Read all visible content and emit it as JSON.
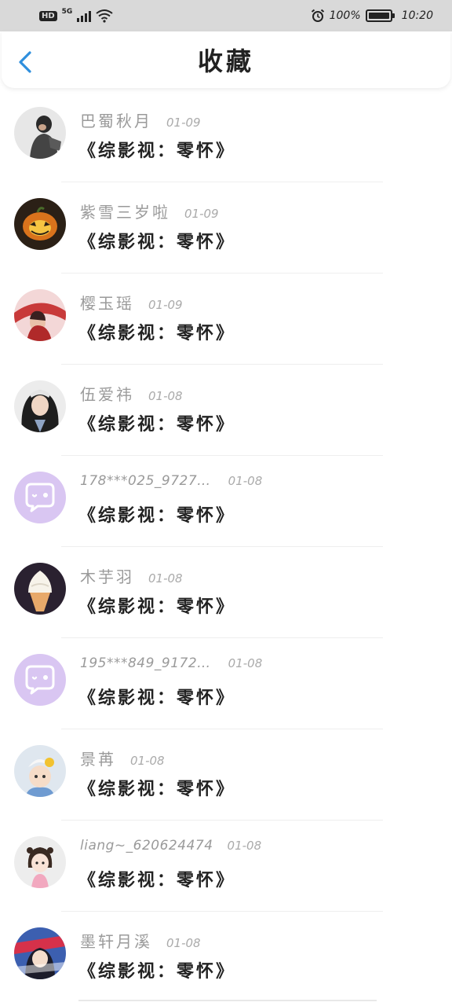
{
  "status_bar": {
    "hd": "HD",
    "network": "5G",
    "battery": "100%",
    "time": "10:20"
  },
  "header": {
    "title": "收藏",
    "back_icon": "chevron-left-icon",
    "accent_color": "#2f8fdd"
  },
  "items": [
    {
      "name": "巴蜀秋月",
      "date": "01-09",
      "title": "《综影视：零怀》",
      "avatar": "photo"
    },
    {
      "name": "紫雪三岁啦",
      "date": "01-09",
      "title": "《综影视：零怀》",
      "avatar": "photo"
    },
    {
      "name": "樱玉瑶",
      "date": "01-09",
      "title": "《综影视：零怀》",
      "avatar": "photo"
    },
    {
      "name": "伍爱祎",
      "date": "01-08",
      "title": "《综影视：零怀》",
      "avatar": "photo"
    },
    {
      "name": "178***025_9727…",
      "date": "01-08",
      "title": "《综影视：零怀》",
      "avatar": "default-chat-icon"
    },
    {
      "name": "木芋羽",
      "date": "01-08",
      "title": "《综影视：零怀》",
      "avatar": "photo"
    },
    {
      "name": "195***849_9172…",
      "date": "01-08",
      "title": "《综影视：零怀》",
      "avatar": "default-chat-icon"
    },
    {
      "name": "景苒",
      "date": "01-08",
      "title": "《综影视：零怀》",
      "avatar": "photo"
    },
    {
      "name": "liang~_620624474",
      "date": "01-08",
      "title": "《综影视：零怀》",
      "avatar": "photo"
    },
    {
      "name": "墨轩月溪",
      "date": "01-08",
      "title": "《综影视：零怀》",
      "avatar": "photo"
    }
  ]
}
